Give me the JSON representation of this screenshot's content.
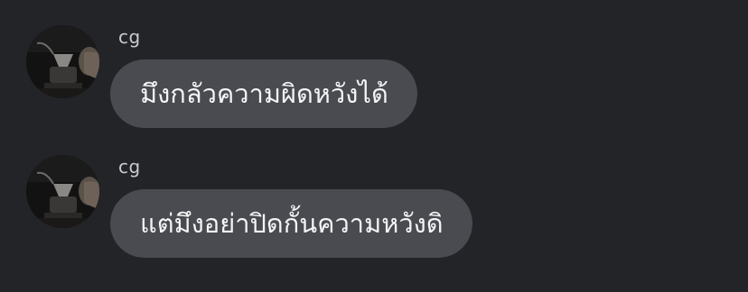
{
  "messages": [
    {
      "sender": "cg",
      "text": "มึงกลัวความผิดหวังได้",
      "avatar_icon": "avatar-photo-coffee-pour-over"
    },
    {
      "sender": "cg",
      "text": "แต่มึงอย่าปิดกั้นความหวังดิ",
      "avatar_icon": "avatar-photo-coffee-pour-over"
    }
  ],
  "colors": {
    "background": "#232428",
    "bubble": "#4a4b50",
    "bubble_text": "#f4f4f6",
    "sender_text": "#c9cacd"
  }
}
